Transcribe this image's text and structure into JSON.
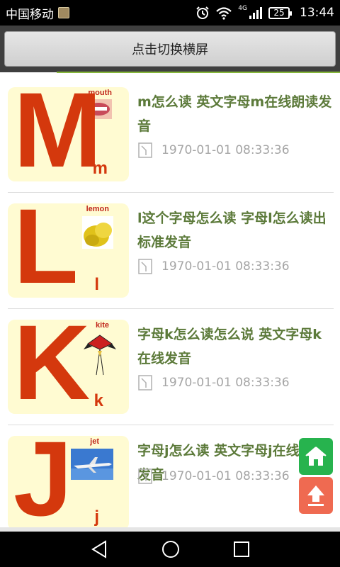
{
  "status_bar": {
    "carrier": "中国移动",
    "network": "4G",
    "battery": "25",
    "time": "13:44"
  },
  "toolbar": {
    "landscape_button_label": "点击切换横屏"
  },
  "articles": [
    {
      "title": "m怎么读 英文字母m在线朗读发音",
      "time": "1970-01-01 08:33:36",
      "thumb": {
        "big_letter": "M",
        "small_letter": "m",
        "word": "mouth"
      }
    },
    {
      "title": "l这个字母怎么读 字母l怎么读出标准发音",
      "time": "1970-01-01 08:33:36",
      "thumb": {
        "big_letter": "L",
        "small_letter": "l",
        "word": "lemon"
      }
    },
    {
      "title": "字母k怎么读怎么说 英文字母k在线发音",
      "time": "1970-01-01 08:33:36",
      "thumb": {
        "big_letter": "K",
        "small_letter": "k",
        "word": "kite"
      }
    },
    {
      "title": "字母j怎么读 英文字母j在线朗读发音",
      "time": "1970-01-01 08:33:36",
      "thumb": {
        "big_letter": "J",
        "small_letter": "j",
        "word": "jet"
      }
    }
  ],
  "icons": {
    "status": [
      "alarm-icon",
      "wifi-icon",
      "signal-icon",
      "battery-icon"
    ],
    "floating": [
      "home-icon",
      "arrow-up-icon"
    ],
    "navigation": [
      "back-icon",
      "home-circle-icon",
      "recents-icon"
    ]
  },
  "colors": {
    "title_green": "#5c7a3a",
    "letter_red": "#d4380d",
    "thumb_bg": "#fffbd2",
    "home_fab": "#27b34e",
    "top_fab": "#ef6a51",
    "accent_line": "#86b73a"
  }
}
